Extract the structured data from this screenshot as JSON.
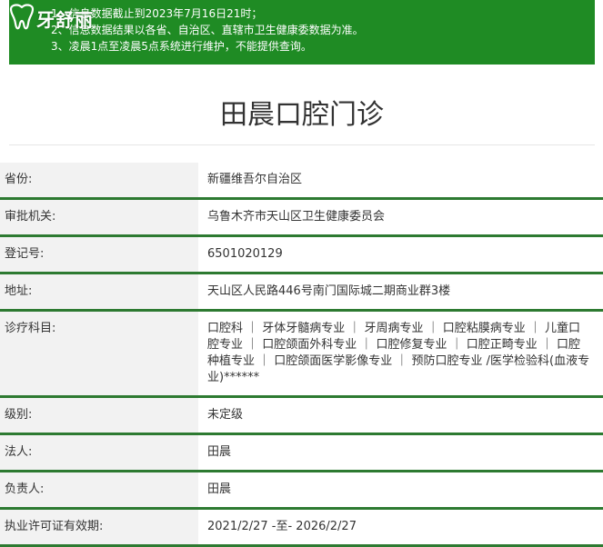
{
  "site": {
    "logo_text": "牙舒丽"
  },
  "notice": {
    "lines": [
      "1、信息数据截止到2023年7月16日21时；",
      "2、信息数据结果以各省、自治区、直辖市卫生健康委数据为准。",
      "3、凌晨1点至凌晨5点系统进行维护，不能提供查询。"
    ]
  },
  "clinic": {
    "title": "田晨口腔门诊",
    "fields": [
      {
        "label": "省份:",
        "value": "新疆维吾尔自治区"
      },
      {
        "label": "审批机关:",
        "value": "乌鲁木齐市天山区卫生健康委员会"
      },
      {
        "label": "登记号:",
        "value": "6501020129"
      },
      {
        "label": "地址:",
        "value": "天山区人民路446号南门国际城二期商业群3楼"
      },
      {
        "label": "诊疗科目:",
        "value": "口腔科 ｜ 牙体牙髓病专业 ｜ 牙周病专业 ｜ 口腔粘膜病专业 ｜ 儿童口腔专业 ｜ 口腔颌面外科专业 ｜ 口腔修复专业 ｜ 口腔正畸专业 ｜ 口腔种植专业 ｜ 口腔颌面医学影像专业 ｜ 预防口腔专业 /医学检验科(血液专业)******"
      },
      {
        "label": "级别:",
        "value": "未定级"
      },
      {
        "label": "法人:",
        "value": "田晨"
      },
      {
        "label": "负责人:",
        "value": "田晨"
      },
      {
        "label": "执业许可证有效期:",
        "value": "2021/2/27 -至- 2026/2/27"
      }
    ]
  },
  "colors": {
    "notice_bg": "#1f8b24",
    "row_border": "#2d7a31",
    "label_bg": "#f2f2f2"
  },
  "icons": {
    "logo": "tooth-icon"
  }
}
